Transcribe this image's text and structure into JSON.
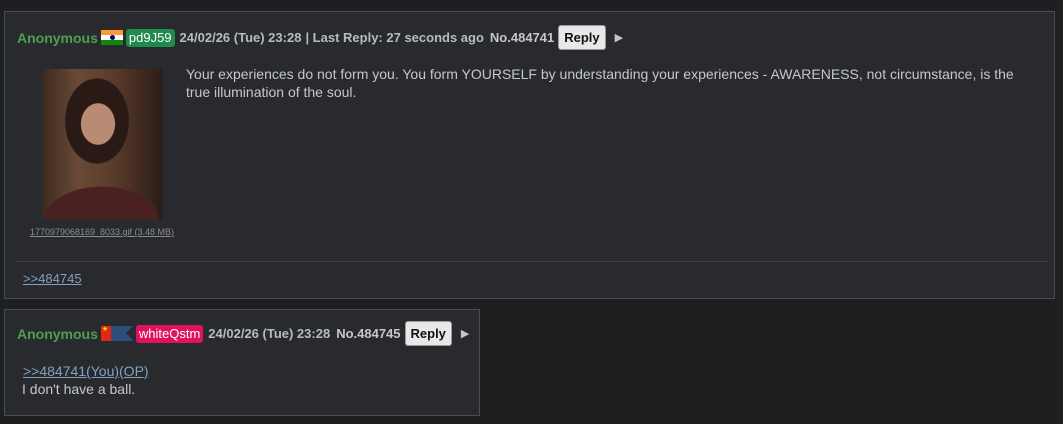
{
  "posts": [
    {
      "name": "Anonymous",
      "flag_icon": "india-flag-icon",
      "poster_id": "pd9J59",
      "datetime": "24/02/26 (Tue) 23:28",
      "last_reply": "| Last Reply: 27 seconds ago",
      "post_no": "No.484741",
      "reply_label": "Reply",
      "menu_icon": "▶",
      "file_name": "1770979068169_8033.gif (3.48 MB)",
      "body": "Your experiences do not form you. You form YOURSELF by understanding your experiences - AWARENESS, not circumstance, is the true illumination of the soul.",
      "backlink": ">>484745"
    },
    {
      "name": "Anonymous",
      "flag_icon": "china-flag-icon",
      "poster_id": "whiteQstm",
      "datetime": "24/02/26 (Tue) 23:28",
      "post_no": "No.484745",
      "reply_label": "Reply",
      "menu_icon": "▶",
      "quote": ">>484741(You)(OP)",
      "body": "I don't have a ball."
    }
  ],
  "colors": {
    "name": "#4f9f4f",
    "id_green": "#1f8a4c",
    "id_pink": "#e0125f",
    "link": "#81a2be"
  }
}
